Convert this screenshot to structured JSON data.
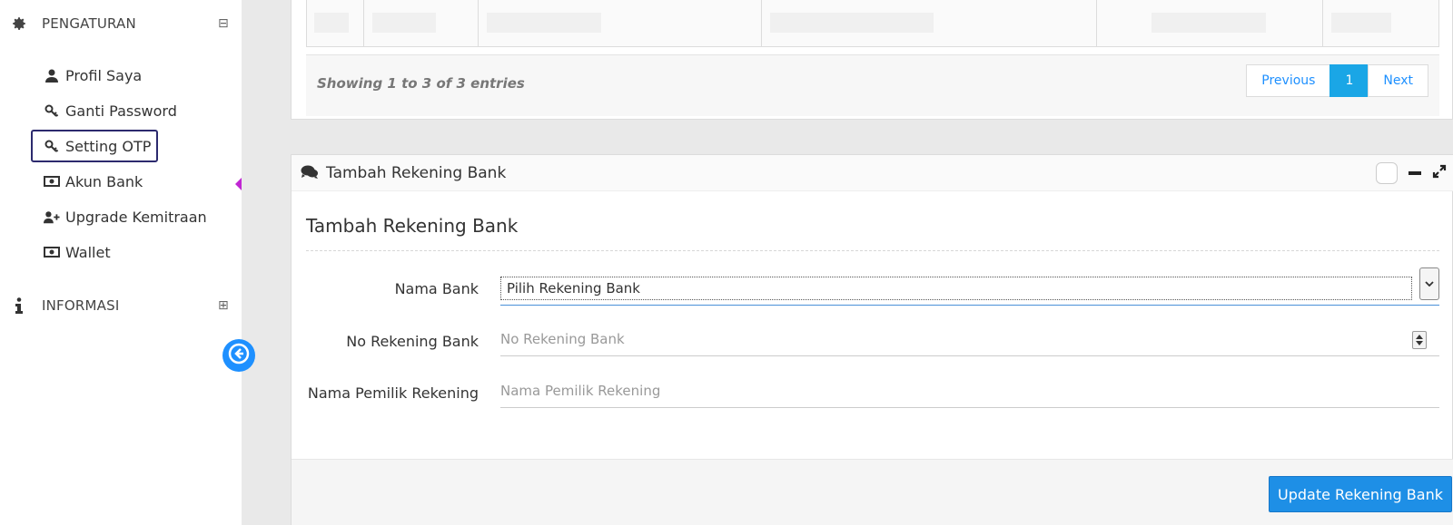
{
  "sidebar": {
    "pengaturan": {
      "label": "PENGATURAN",
      "toggle": "⊟"
    },
    "items": [
      {
        "label": "Profil Saya",
        "icon": "user-icon"
      },
      {
        "label": "Ganti Password",
        "icon": "key-icon"
      },
      {
        "label": "Setting OTP",
        "icon": "key-icon"
      },
      {
        "label": "Akun Bank",
        "icon": "money-icon"
      },
      {
        "label": "Upgrade Kemitraan",
        "icon": "user-plus-icon"
      },
      {
        "label": "Wallet",
        "icon": "money-icon"
      }
    ],
    "informasi": {
      "label": "INFORMASI",
      "toggle": "⊞"
    }
  },
  "table": {
    "showing": "Showing 1 to 3 of 3 entries",
    "pagination": {
      "previous": "Previous",
      "current": "1",
      "next": "Next"
    }
  },
  "form_panel": {
    "header_title": "Tambah Rekening Bank",
    "form_title": "Tambah Rekening Bank",
    "fields": {
      "bank_name": {
        "label": "Nama Bank",
        "value": "Pilih Rekening Bank"
      },
      "account_number": {
        "label": "No Rekening Bank",
        "placeholder": "No Rekening Bank"
      },
      "owner_name": {
        "label": "Nama Pemilik Rekening",
        "placeholder": "Nama Pemilik Rekening"
      }
    },
    "submit_label": "Update Rekening Bank"
  },
  "colors": {
    "accent": "#1e8fe6",
    "active_outline": "#2c2a6e",
    "pointer": "#c026d3"
  }
}
